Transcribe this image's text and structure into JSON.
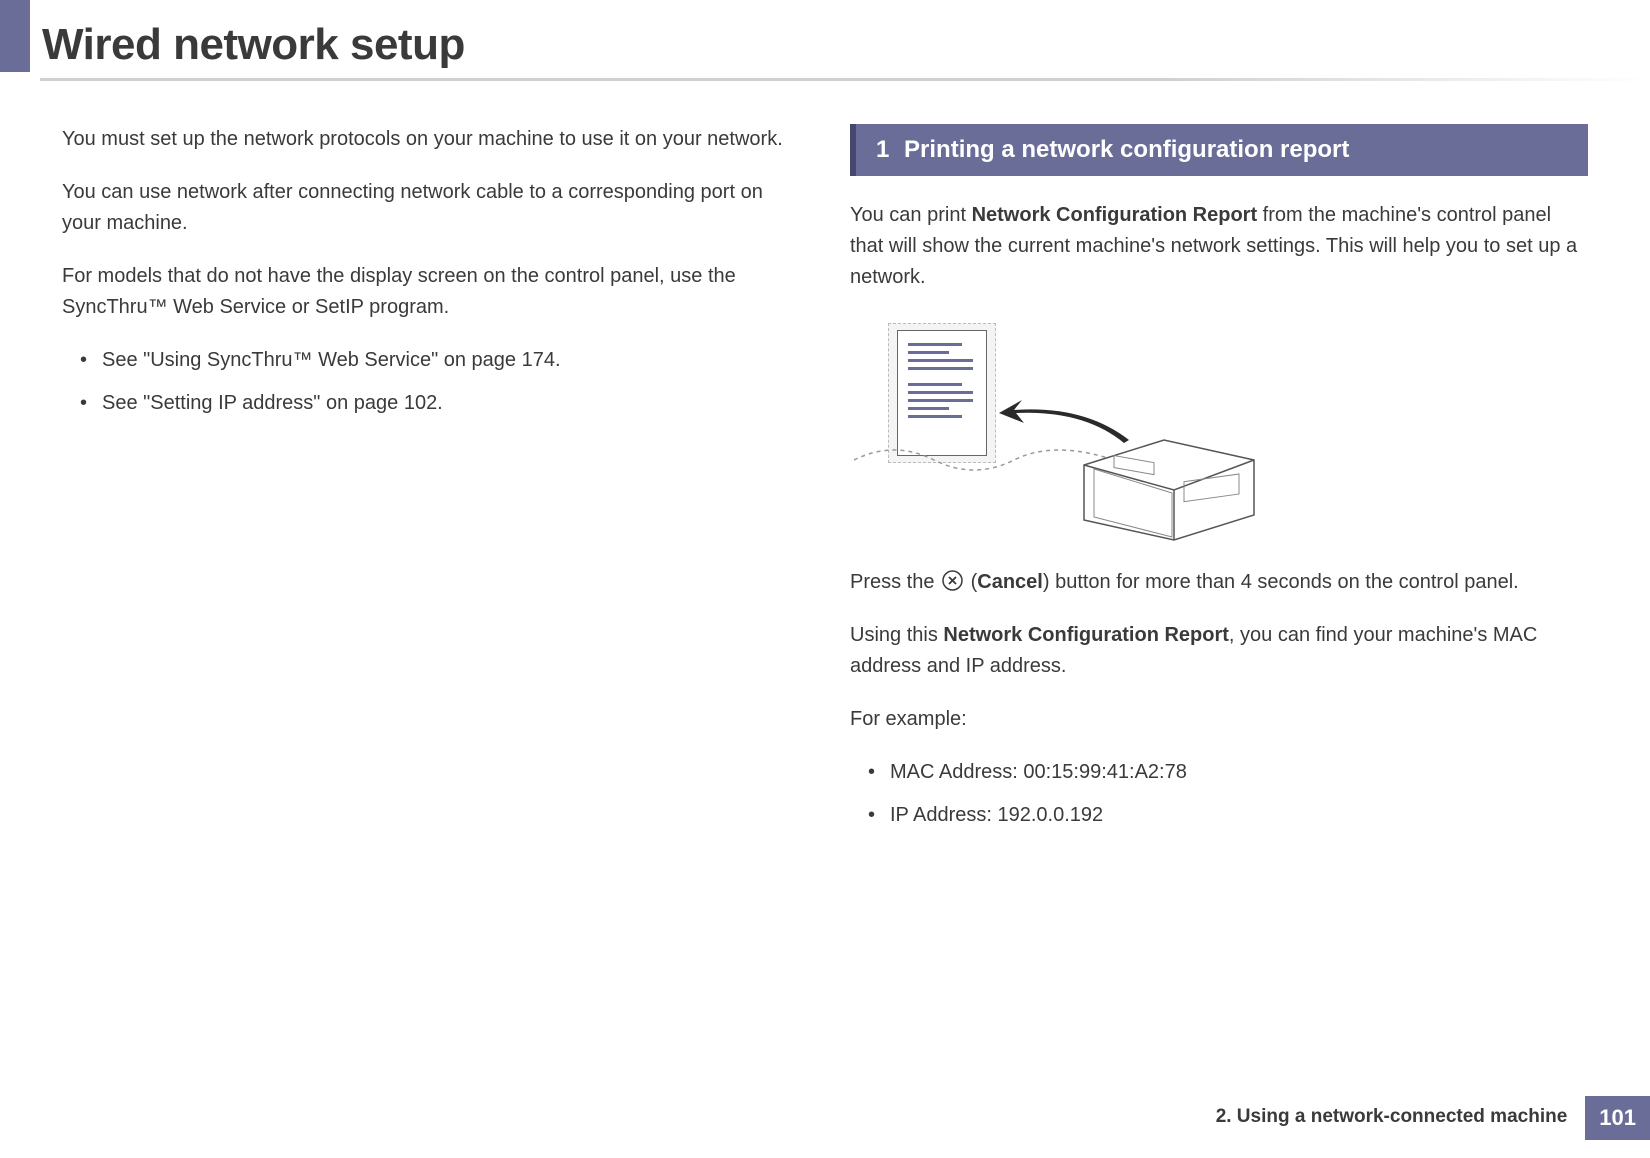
{
  "header": {
    "title": "Wired network setup"
  },
  "left": {
    "p1": "You must set up the network protocols on your machine to use it on your network.",
    "p2": "You can use network after connecting network cable to a corresponding port on your machine.",
    "p3": "For models that do not have the display screen on the control panel, use the SyncThru™ Web Service or SetIP program.",
    "bullets": [
      "See \"Using SyncThru™ Web Service\" on page 174.",
      "See \"Setting IP address\" on page 102."
    ]
  },
  "right": {
    "section_number": "1",
    "section_title": "Printing a network configuration report",
    "intro_pre": "You can print ",
    "intro_bold": "Network Configuration Report",
    "intro_post": " from the machine's control panel that will show the current machine's network settings. This will help you to set up a network.",
    "press_pre": "Press the ",
    "press_bold": "Cancel",
    "press_post": ") button for more than 4 seconds on the control panel.",
    "using_pre": "Using this ",
    "using_bold": "Network Configuration Report",
    "using_post": ", you can find your machine's MAC address and IP address.",
    "example_label": "For example:",
    "example_items": [
      "MAC Address: 00:15:99:41:A2:78",
      "IP Address: 192.0.0.192"
    ]
  },
  "footer": {
    "chapter": "2.  Using a network-connected machine",
    "page": "101"
  }
}
